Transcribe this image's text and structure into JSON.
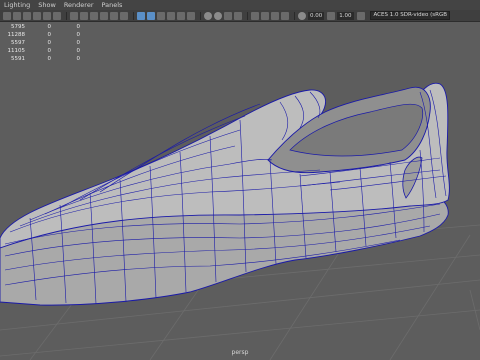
{
  "menu": [
    "Lighting",
    "Show",
    "Renderer",
    "Panels"
  ],
  "toolbar": {
    "exposure_value": "0.00",
    "gamma_value": "1.00",
    "color_space": "ACES 1.0 SDR-video (sRGB"
  },
  "hud_stats": [
    [
      "5795",
      "0",
      "0"
    ],
    [
      "11288",
      "0",
      "0"
    ],
    [
      "5597",
      "0",
      "0"
    ],
    [
      "11105",
      "0",
      "0"
    ],
    [
      "5591",
      "0",
      "0"
    ]
  ],
  "camera_label": "persp",
  "colors": {
    "viewport_bg": "#5d5d5d",
    "grid": "#6b6b6b",
    "wireframe": "#1a1aa8",
    "shoe_fill": "#b7b7b7"
  }
}
